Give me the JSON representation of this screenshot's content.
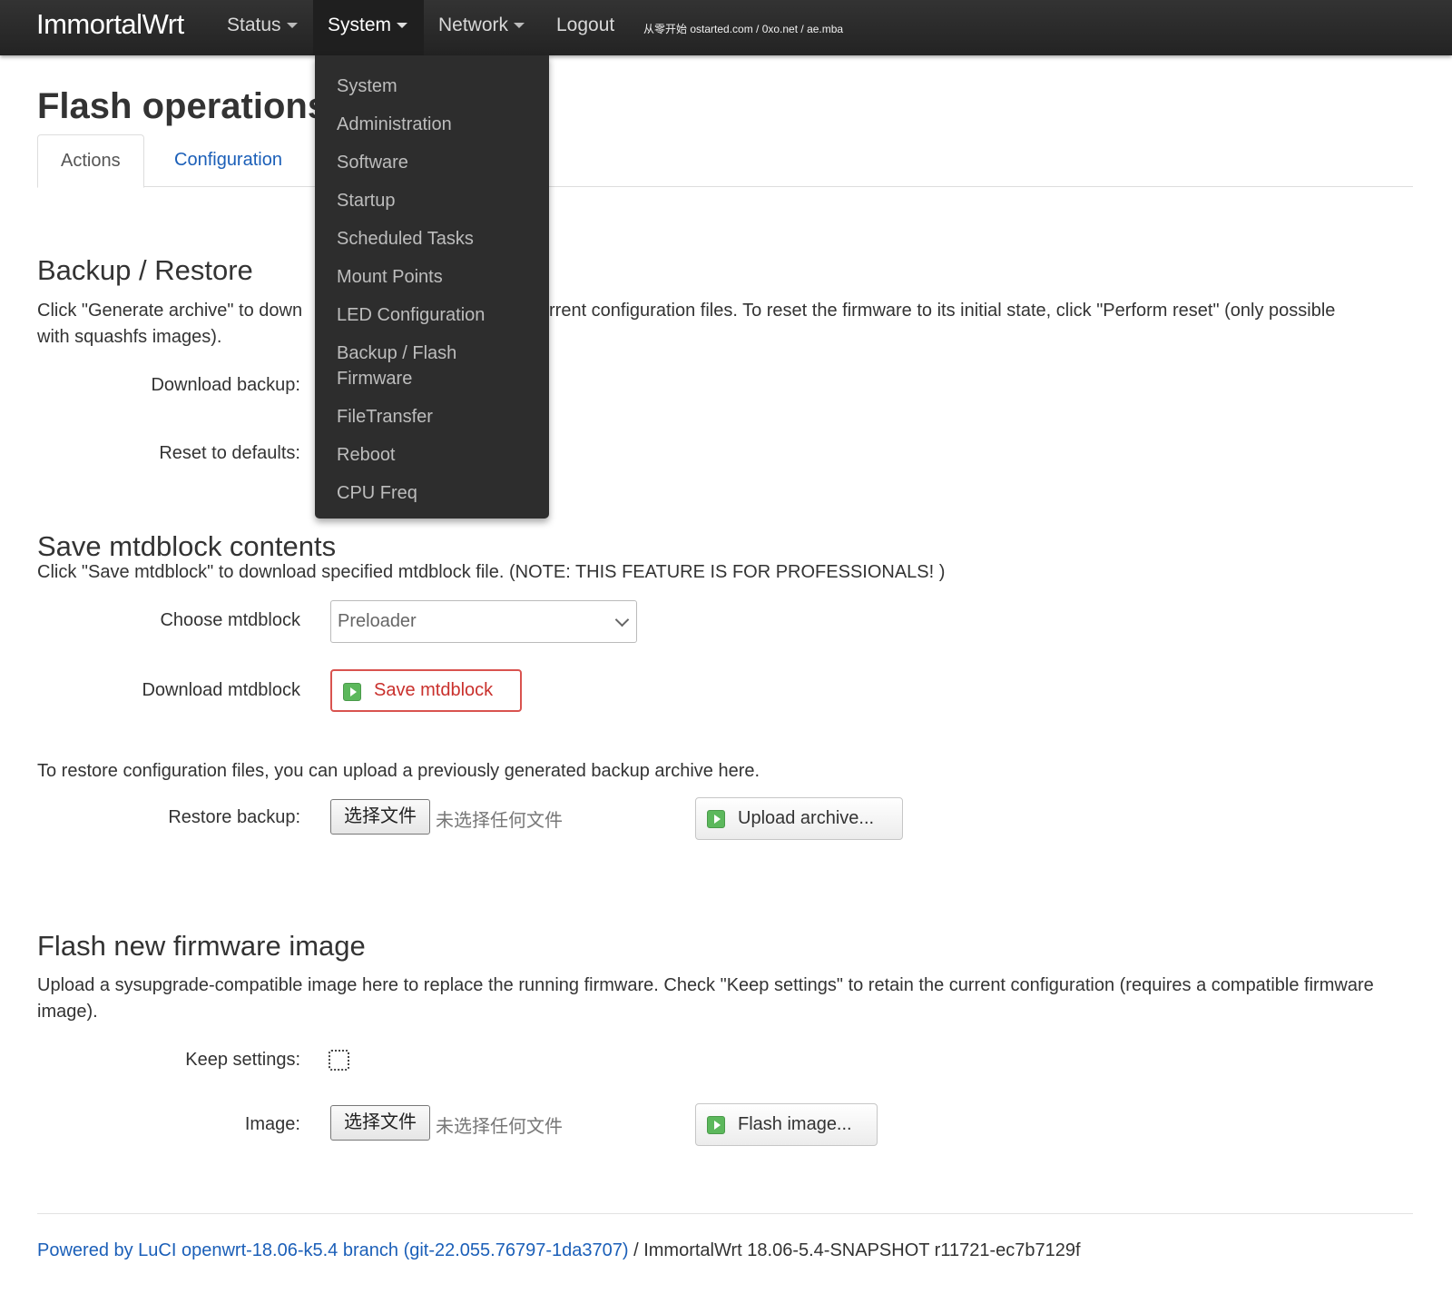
{
  "navbar": {
    "brand": "ImmortalWrt",
    "items": [
      {
        "label": "Status"
      },
      {
        "label": "System"
      },
      {
        "label": "Network"
      },
      {
        "label": "Logout"
      }
    ],
    "note": "从零开始 ostarted.com / 0xo.net / ae.mba"
  },
  "dropdown": {
    "items": [
      "System",
      "Administration",
      "Software",
      "Startup",
      "Scheduled Tasks",
      "Mount Points",
      "LED Configuration",
      "Backup / Flash Firmware",
      "FileTransfer",
      "Reboot",
      "CPU Freq"
    ]
  },
  "page": {
    "title": "Flash operations",
    "tabs": [
      "Actions",
      "Configuration"
    ]
  },
  "backup": {
    "heading": "Backup / Restore",
    "desc_left": "Click \"Generate archive\" to down",
    "desc_right": "rrent configuration files. To reset the firmware to its initial state, click \"Perform reset\" (only possible",
    "desc_line2": "with squashfs images).",
    "download_label": "Download backup:",
    "reset_label": "Reset to defaults:"
  },
  "mtd": {
    "heading": "Save mtdblock contents",
    "desc": "Click \"Save mtdblock\" to download specified mtdblock file. (NOTE: THIS FEATURE IS FOR PROFESSIONALS! )",
    "choose_label": "Choose mtdblock",
    "selected": "Preloader",
    "download_label": "Download mtdblock",
    "save_button": "Save mtdblock"
  },
  "restore": {
    "desc": "To restore configuration files, you can upload a previously generated backup archive here.",
    "label": "Restore backup:",
    "choose_file": "选择文件",
    "no_file": "未选择任何文件",
    "upload_button": "Upload archive..."
  },
  "flash": {
    "heading": "Flash new firmware image",
    "desc": "Upload a sysupgrade-compatible image here to replace the running firmware. Check \"Keep settings\" to retain the current configuration (requires a compatible firmware image).",
    "keep_label": "Keep settings:",
    "keep_checked": false,
    "image_label": "Image:",
    "choose_file": "选择文件",
    "no_file": "未选择任何文件",
    "flash_button": "Flash image..."
  },
  "footer": {
    "link": "Powered by LuCI openwrt-18.06-k5.4 branch (git-22.055.76797-1da3707)",
    "text": " / ImmortalWrt 18.06-5.4-SNAPSHOT r11721-ec7b7129f"
  },
  "colors": {
    "navbar": "#2b2b2b",
    "link": "#1b5fb8",
    "danger": "#d9534f",
    "icon_green": "#5cb85c"
  }
}
